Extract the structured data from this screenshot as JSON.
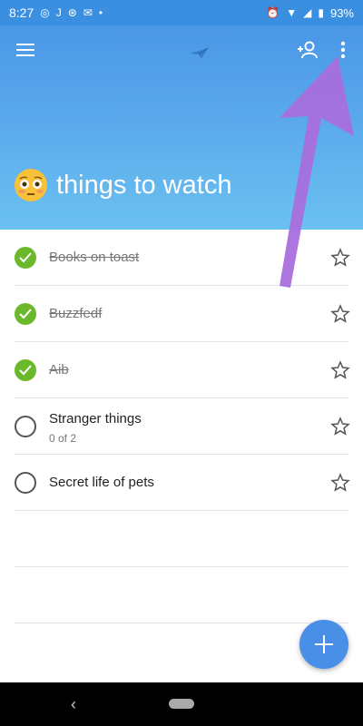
{
  "status_bar": {
    "time": "8:27",
    "battery": "93%",
    "left_icons": [
      "whatsapp-icon",
      "j-icon",
      "sync-icon",
      "mail-icon",
      "dot-icon"
    ],
    "right_icons": [
      "alarm-icon",
      "wifi-icon",
      "signal-icon",
      "battery-icon"
    ]
  },
  "header": {
    "title": "things to watch",
    "emoji": "flushed-face-icon",
    "background_top": "#4a97e6",
    "background_bottom": "#6bc1f0"
  },
  "tasks": [
    {
      "text": "Books on toast",
      "completed": true
    },
    {
      "text": "Buzzfedf",
      "completed": true
    },
    {
      "text": "Aib",
      "completed": true
    },
    {
      "text": "Stranger things",
      "completed": false,
      "subtitle": "0 of 2"
    },
    {
      "text": "Secret life of pets",
      "completed": false
    }
  ],
  "colors": {
    "check_done": "#6bb82a",
    "fab": "#4a8fe7",
    "annotation_arrow": "#a86fdc"
  }
}
